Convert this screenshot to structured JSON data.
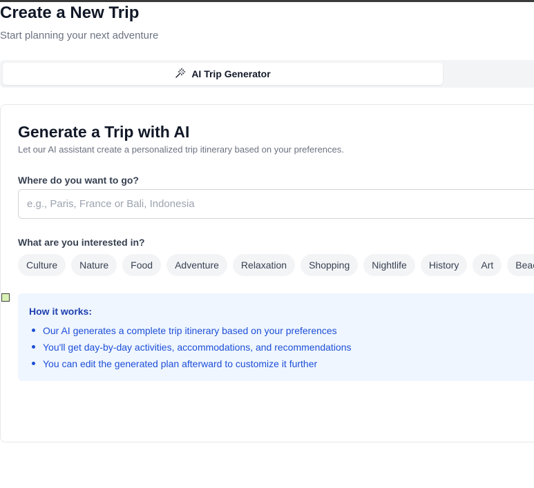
{
  "header": {
    "title": "Create a New Trip",
    "subtitle": "Start planning your next adventure"
  },
  "tabs": [
    {
      "label": "AI Trip Generator",
      "icon": "magic-wand-icon",
      "active": true
    }
  ],
  "card": {
    "title": "Generate a Trip with AI",
    "description": "Let our AI assistant create a personalized trip itinerary based on your preferences."
  },
  "destination": {
    "label": "Where do you want to go?",
    "value": "",
    "placeholder": "e.g., Paris, France or Bali, Indonesia"
  },
  "interests": {
    "label": "What are you interested in?",
    "options": [
      "Culture",
      "Nature",
      "Food",
      "Adventure",
      "Relaxation",
      "Shopping",
      "Nightlife",
      "History",
      "Art",
      "Beach"
    ]
  },
  "how_it_works": {
    "title": "How it works:",
    "items": [
      "Our AI generates a complete trip itinerary based on your preferences",
      "You'll get day-by-day activities, accommodations, and recommendations",
      "You can edit the generated plan afterward to customize it further"
    ]
  },
  "colors": {
    "accent_blue": "#1d4ed8",
    "info_bg": "#eff6ff",
    "chip_bg": "#f3f4f6"
  }
}
